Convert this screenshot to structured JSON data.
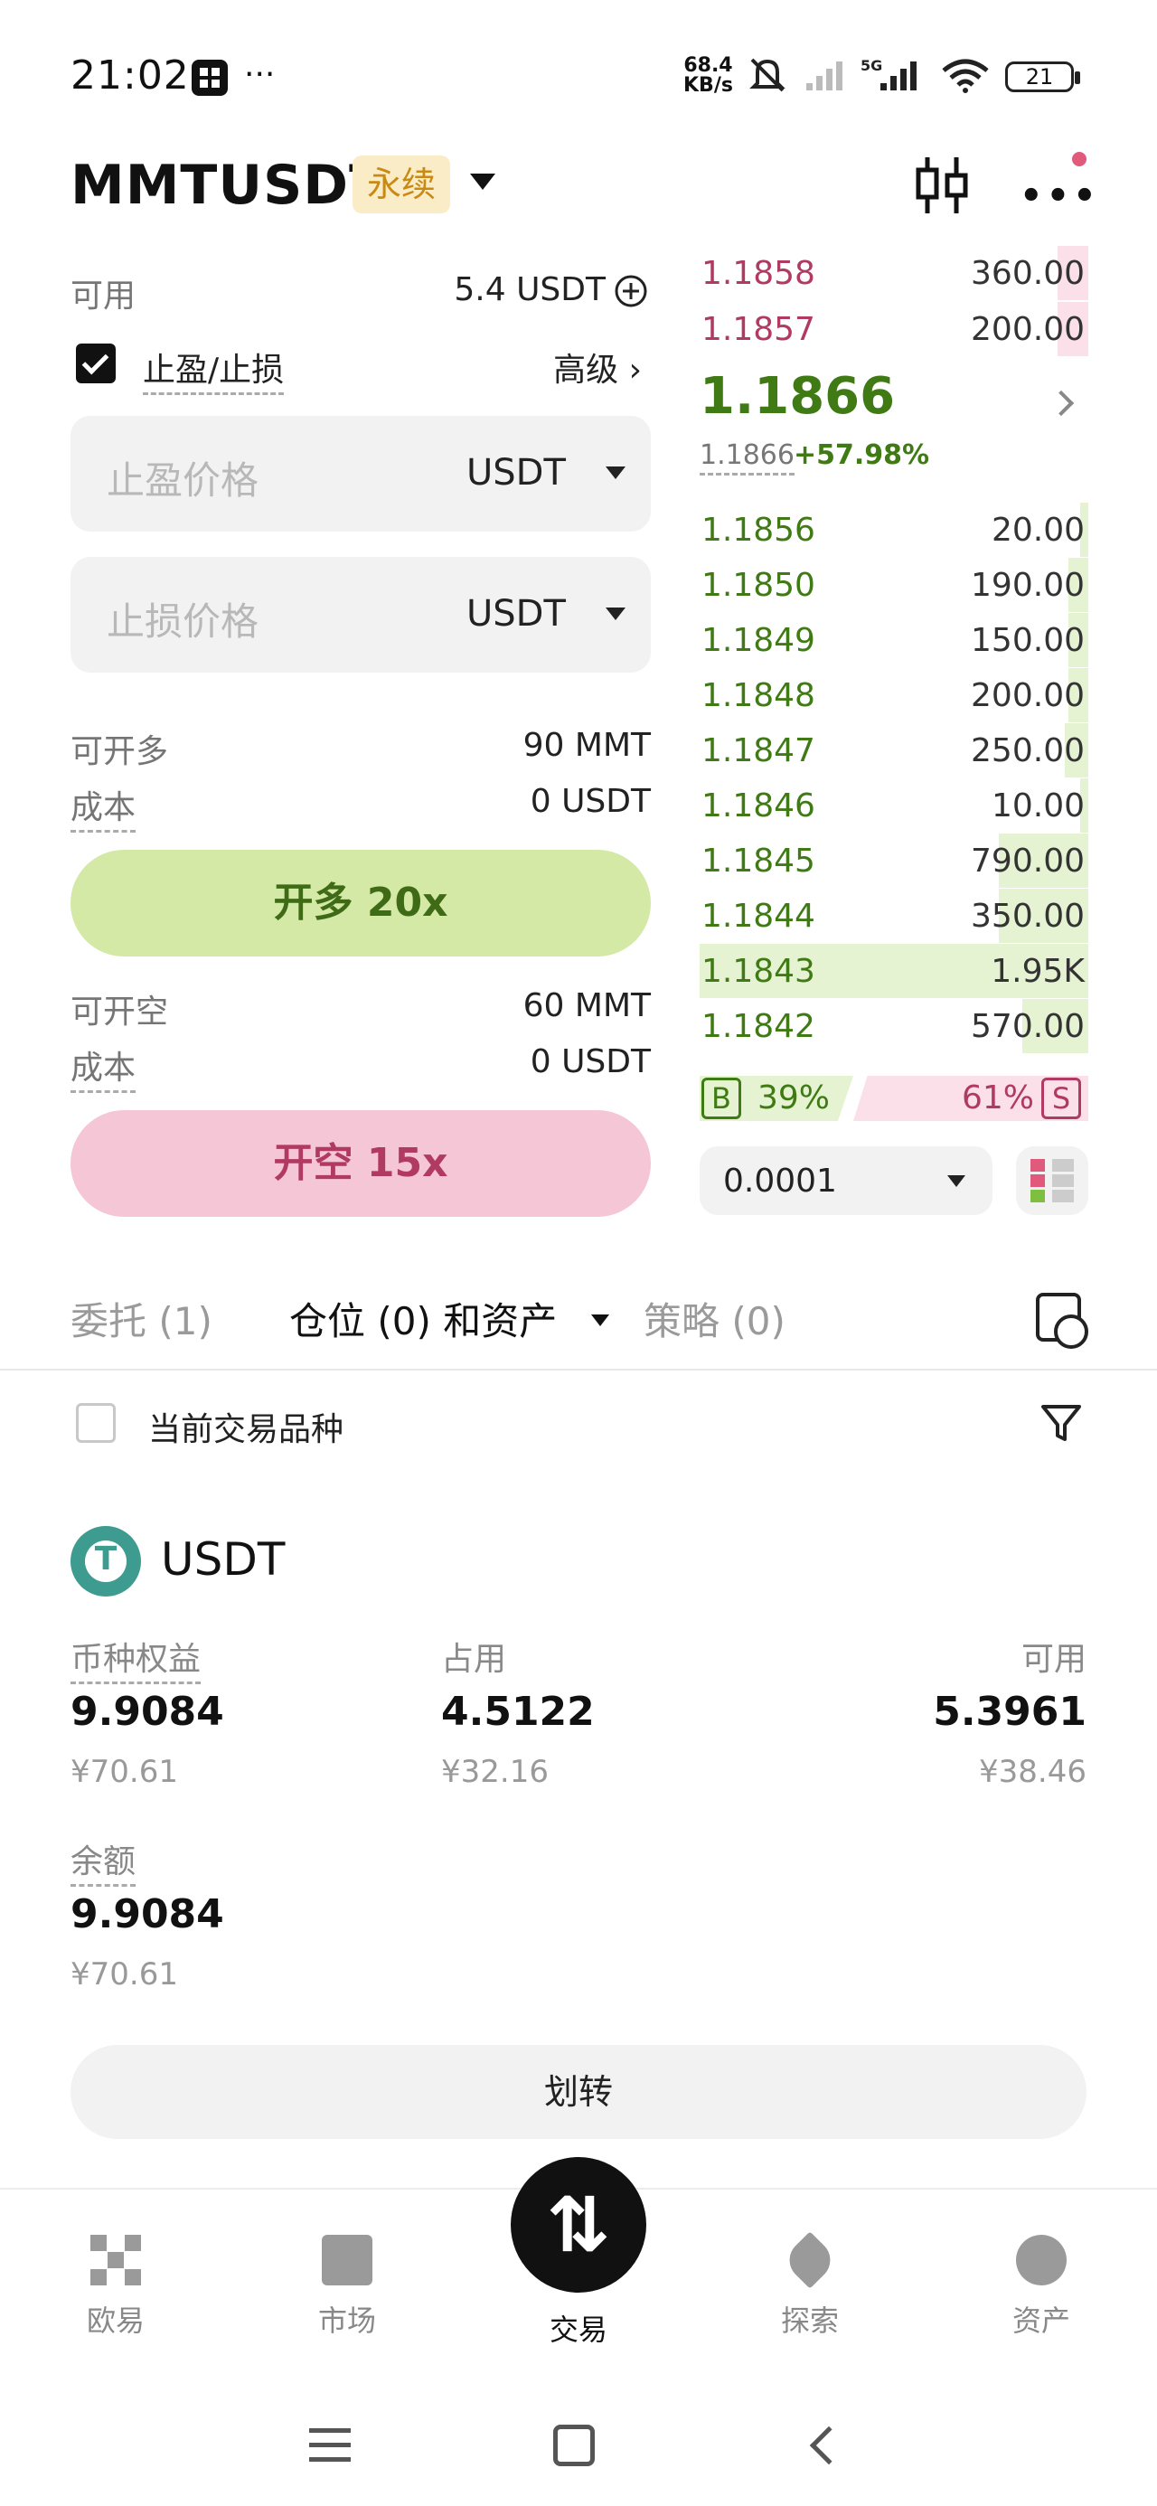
{
  "status_bar": {
    "time": "21:02",
    "more": "···",
    "net_speed_top": "68.4",
    "net_speed_bottom": "KB/s",
    "net_type": "5G",
    "battery": "21"
  },
  "header": {
    "pair": "MMTUSDT",
    "contract_type": "永续"
  },
  "order_form": {
    "available_label": "可用",
    "available_value": "5.4 USDT",
    "tpsl_label": "止盈/止损",
    "advanced_label": "高级 ›",
    "tp_placeholder": "止盈价格",
    "tp_unit": "USDT",
    "sl_placeholder": "止损价格",
    "sl_unit": "USDT",
    "can_long_label": "可开多",
    "can_long_value": "90 MMT",
    "cost_label": "成本",
    "long_cost_value": "0 USDT",
    "long_button": "开多 20x",
    "can_short_label": "可开空",
    "can_short_value": "60 MMT",
    "short_cost_value": "0 USDT",
    "short_button": "开空 15x"
  },
  "order_book": {
    "asks": [
      {
        "price": "1.1858",
        "qty": "360.00",
        "depth": 0.08
      },
      {
        "price": "1.1857",
        "qty": "200.00",
        "depth": 0.08
      }
    ],
    "last_price": "1.1866",
    "mark_price": "1.1866",
    "change": "+57.98%",
    "bids": [
      {
        "price": "1.1856",
        "qty": "20.00",
        "depth": 0.02
      },
      {
        "price": "1.1850",
        "qty": "190.00",
        "depth": 0.05
      },
      {
        "price": "1.1849",
        "qty": "150.00",
        "depth": 0.05
      },
      {
        "price": "1.1848",
        "qty": "200.00",
        "depth": 0.05
      },
      {
        "price": "1.1847",
        "qty": "250.00",
        "depth": 0.06
      },
      {
        "price": "1.1846",
        "qty": "10.00",
        "depth": 0.02
      },
      {
        "price": "1.1845",
        "qty": "790.00",
        "depth": 0.23
      },
      {
        "price": "1.1844",
        "qty": "350.00",
        "depth": 0.23
      },
      {
        "price": "1.1843",
        "qty": "1.95K",
        "depth": 1.0
      },
      {
        "price": "1.1842",
        "qty": "570.00",
        "depth": 0.17
      }
    ],
    "buy_tag": "B",
    "buy_pct": "39%",
    "sell_tag": "S",
    "sell_pct": "61%",
    "precision": "0.0001"
  },
  "tabs": [
    {
      "label": "委托 (1)"
    },
    {
      "label": "仓位 (0) 和资产"
    },
    {
      "label": "策略 (0)"
    }
  ],
  "filter": {
    "current_pair_label": "当前交易品种"
  },
  "asset": {
    "coin": "USDT",
    "equity_label": "币种权益",
    "equity_value": "9.9084",
    "equity_cny": "¥70.61",
    "used_label": "占用",
    "used_value": "4.5122",
    "used_cny": "¥32.16",
    "available_label": "可用",
    "available_value": "5.3961",
    "available_cny": "¥38.46",
    "balance_label": "余额",
    "balance_value": "9.9084",
    "balance_cny": "¥70.61",
    "transfer_button": "划转"
  },
  "bottom_nav": [
    {
      "label": "欧易",
      "icon": "okx-logo-icon"
    },
    {
      "label": "市场",
      "icon": "chart-icon"
    },
    {
      "label": "交易",
      "icon": "trade-arrows-icon"
    },
    {
      "label": "探索",
      "icon": "explore-icon"
    },
    {
      "label": "资产",
      "icon": "pie-icon"
    }
  ]
}
